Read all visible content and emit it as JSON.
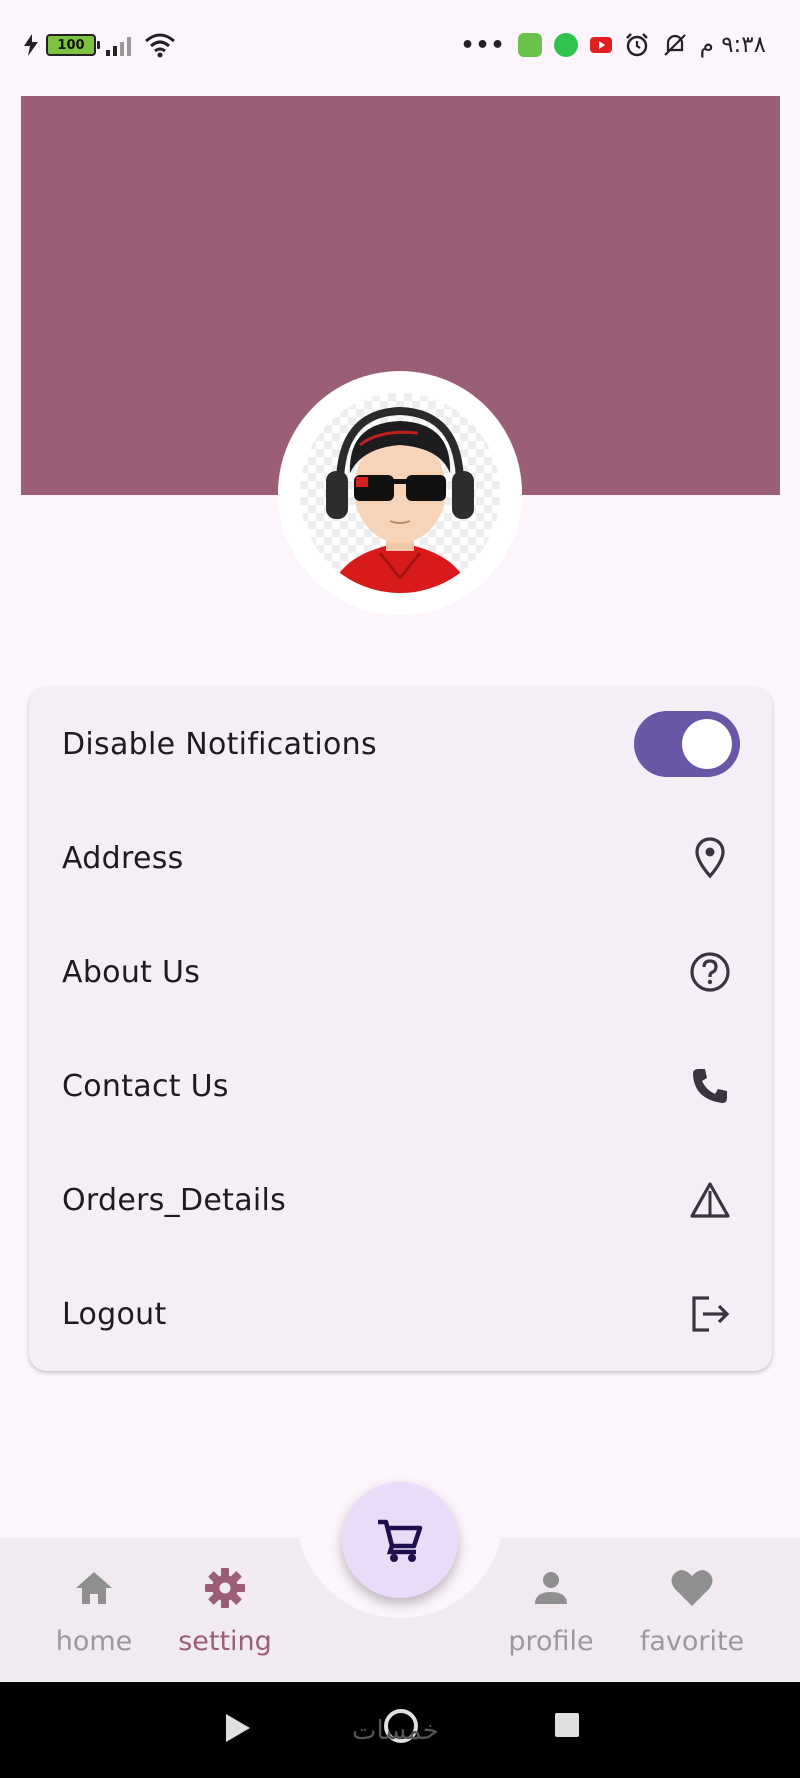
{
  "status_bar": {
    "battery_level": "100",
    "time": "٩:٣٨ م"
  },
  "settings": {
    "items": [
      {
        "label": "Disable Notifications",
        "icon": "toggle-switch",
        "toggle_on": true
      },
      {
        "label": "Address",
        "icon": "location-pin-icon"
      },
      {
        "label": "About Us",
        "icon": "help-circle-icon"
      },
      {
        "label": "Contact Us",
        "icon": "phone-icon"
      },
      {
        "label": "Orders_Details",
        "icon": "warning-triangle-icon"
      },
      {
        "label": "Logout",
        "icon": "logout-icon"
      }
    ]
  },
  "bottom_nav": {
    "items": [
      {
        "label": "home",
        "icon": "home-icon",
        "active": false
      },
      {
        "label": "setting",
        "icon": "gear-icon",
        "active": true
      },
      {
        "label": "profile",
        "icon": "person-icon",
        "active": false
      },
      {
        "label": "favorite",
        "icon": "heart-icon",
        "active": false
      }
    ],
    "fab_icon": "cart-icon"
  },
  "watermark": "خمسات",
  "colors": {
    "banner": "#9a5f77",
    "accent": "#6a56a6",
    "active_nav": "#9a5f77",
    "fab": "#eadcf8",
    "card": "#f4eff6"
  }
}
